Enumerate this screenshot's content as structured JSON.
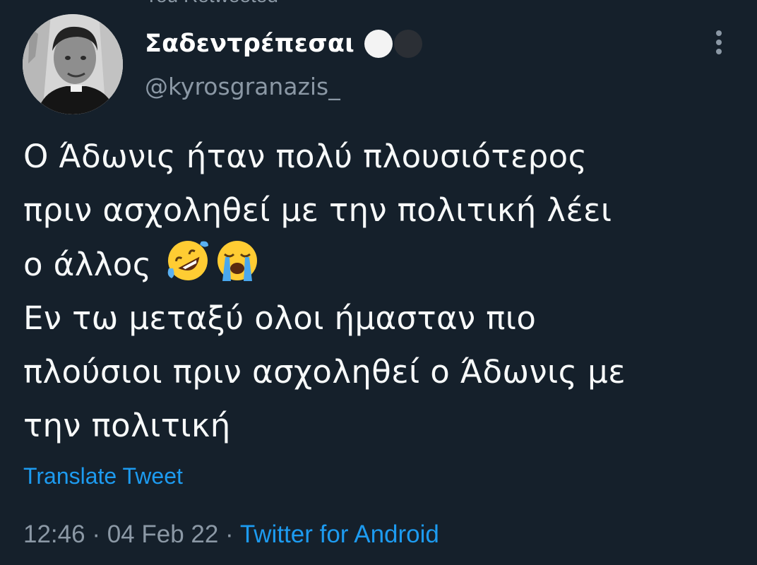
{
  "header": {
    "partial_text": "You Retweeted"
  },
  "author": {
    "display_name": "Σαδεντρέπεσαι",
    "handle": "@kyrosgranazis_",
    "name_emojis": [
      "white-circle-icon",
      "black-circle-icon"
    ]
  },
  "tweet": {
    "text_part1": "Ο Άδωνις ήταν πολύ πλουσιότερος\nπριν ασχοληθεί με την πολιτική λέει\nο άλλος ",
    "text_part2": "\nΕν τω μεταξύ ολοι ήμασταν πιο\nπλούσιοι πριν ασχοληθεί ο Άδωνις με\nτην πολιτική",
    "emojis": [
      "rolling-on-floor-laughing-icon",
      "loudly-crying-face-icon"
    ],
    "translate_label": "Translate Tweet"
  },
  "meta": {
    "time": "12:46",
    "separator1": " · ",
    "date": "04 Feb 22",
    "separator2": " · ",
    "source": "Twitter for Android"
  },
  "colors": {
    "background": "#15202b",
    "text": "#f7f9f9",
    "secondary": "#8b98a5",
    "link": "#1d9bf0"
  }
}
